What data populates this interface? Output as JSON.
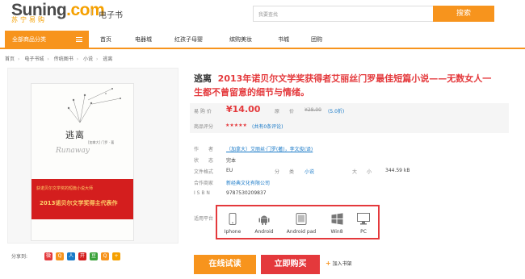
{
  "header": {
    "logo_main_s": "Suning",
    "logo_main_com": ".com",
    "logo_sub": "苏宁易购",
    "divider": "|",
    "section": "电子书",
    "search_placeholder": "我要查找",
    "search_button": "搜索"
  },
  "nav": {
    "all_label": "全部商品分类",
    "items": [
      "首页",
      "电器城",
      "红孩子母婴",
      "缤购美妆",
      "书城",
      "团购"
    ]
  },
  "breadcrumb": [
    "首页",
    "电子书城",
    "传统图书",
    "小说",
    "逃离"
  ],
  "cover": {
    "title": "逃离",
    "title_en": "Runaway",
    "authors": "[加拿大] 门罗 · 著",
    "red_line1": "获诺贝尔文学奖的短篇小说大师",
    "red_line2": "2013诺贝尔文学奖得主代表作"
  },
  "share": {
    "label": "分享到:",
    "icons": [
      {
        "name": "weibo-share-icon",
        "color": "#e4393c",
        "glyph": "微"
      },
      {
        "name": "qzone-share-icon",
        "color": "#f7941d",
        "glyph": "Q"
      },
      {
        "name": "renren-share-icon",
        "color": "#1a7ac8",
        "glyph": "人"
      },
      {
        "name": "kaixin-share-icon",
        "color": "#d41e1e",
        "glyph": "开"
      },
      {
        "name": "douban-share-icon",
        "color": "#3aa23a",
        "glyph": "豆"
      },
      {
        "name": "tqq-share-icon",
        "color": "#f7941d",
        "glyph": "Q"
      },
      {
        "name": "more-share-icon",
        "color": "#f5a000",
        "glyph": "+"
      }
    ]
  },
  "product": {
    "name": "逃离",
    "headline": "2013年诺贝尔文学奖获得者艾丽丝门罗最佳短篇小说——无数女人一生都不曾留意的细节与情绪。",
    "price_label": "易 购 价",
    "price": "¥14.00",
    "orig_label": "原　　价",
    "orig_price": "¥28.00",
    "discount": "(5.0折)",
    "rating_label": "商品评分",
    "stars": "★★★★★",
    "reviews": "(共有0条评论)",
    "author_label": "作　　者",
    "author": "（加拿大）艾丽丝·门罗(著)，李文俊(译)",
    "status_label": "状　　态",
    "status": "完本",
    "size_label": "文件格式",
    "format": "EU",
    "category_label": "分　　类",
    "category": "小说",
    "filesize_label": "大　　小",
    "filesize": "344.59 kB",
    "publisher_label": "合作商家",
    "publisher": "新经典文化有限公司",
    "isbn_label": "I S B N",
    "isbn": "9787530209837",
    "platform_label": "适用平台",
    "platforms": [
      "Iphone",
      "Android",
      "Android pad",
      "Win8",
      "PC"
    ]
  },
  "actions": {
    "read_online": "在线试读",
    "buy_now": "立即购买",
    "add_shelf": "加入书架"
  },
  "colors": {
    "brand_orange": "#f7941d",
    "price_red": "#e4393c",
    "link_blue": "#1a7ac8"
  }
}
